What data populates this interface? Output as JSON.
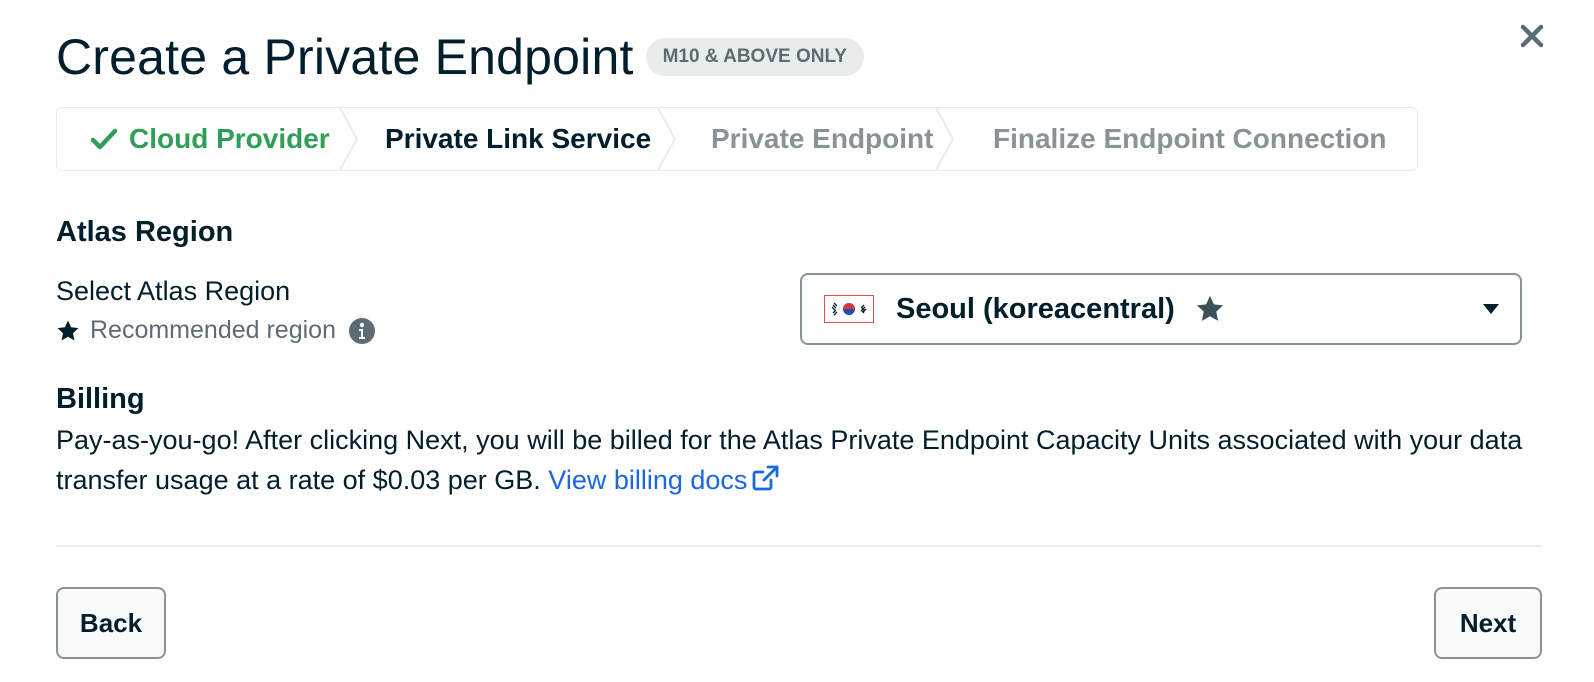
{
  "header": {
    "title": "Create a Private Endpoint",
    "badge": "M10 & ABOVE ONLY"
  },
  "stepper": {
    "steps": [
      {
        "label": "Cloud Provider",
        "state": "completed"
      },
      {
        "label": "Private Link Service",
        "state": "current"
      },
      {
        "label": "Private Endpoint",
        "state": "upcoming"
      },
      {
        "label": "Finalize Endpoint Connection",
        "state": "upcoming"
      }
    ]
  },
  "region": {
    "heading": "Atlas Region",
    "select_label": "Select Atlas Region",
    "recommended_text": "Recommended region",
    "selected_value": "Seoul (koreacentral)",
    "flag_icon": "south-korea-flag-icon"
  },
  "billing": {
    "heading": "Billing",
    "text": "Pay-as-you-go! After clicking Next, you will be billed for the Atlas Private Endpoint Capacity Units associated with your data transfer usage at a rate of $0.03 per GB. ",
    "link_label": "View billing docs"
  },
  "footer": {
    "back_label": "Back",
    "next_label": "Next"
  },
  "colors": {
    "completed": "#2f9e57",
    "current": "#001e2b",
    "upcoming": "#889397",
    "link": "#1a67e0",
    "badge_bg": "#e8edeb"
  },
  "icons": [
    "close-icon",
    "check-icon",
    "star-icon",
    "info-icon",
    "chevron-down-icon",
    "external-link-icon"
  ]
}
